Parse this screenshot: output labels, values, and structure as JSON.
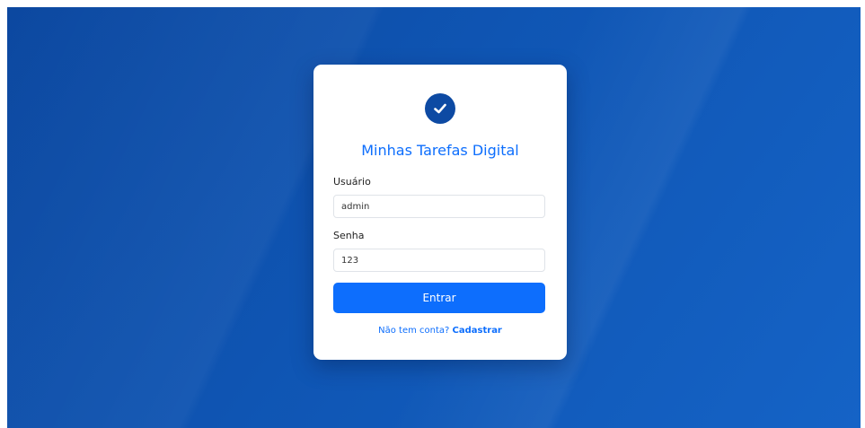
{
  "app": {
    "title": "Minhas Tarefas Digital",
    "logo_icon": "check-circle-icon"
  },
  "form": {
    "username_label": "Usuário",
    "username_value": "admin",
    "password_label": "Senha",
    "password_value": "123",
    "submit_label": "Entrar"
  },
  "signup": {
    "prompt": "Não tem conta?",
    "link_label": "Cadastrar"
  },
  "colors": {
    "background": "#0f55b3",
    "primary": "#0d6efd",
    "logo_circle": "#0d4aa3",
    "card": "#ffffff"
  }
}
